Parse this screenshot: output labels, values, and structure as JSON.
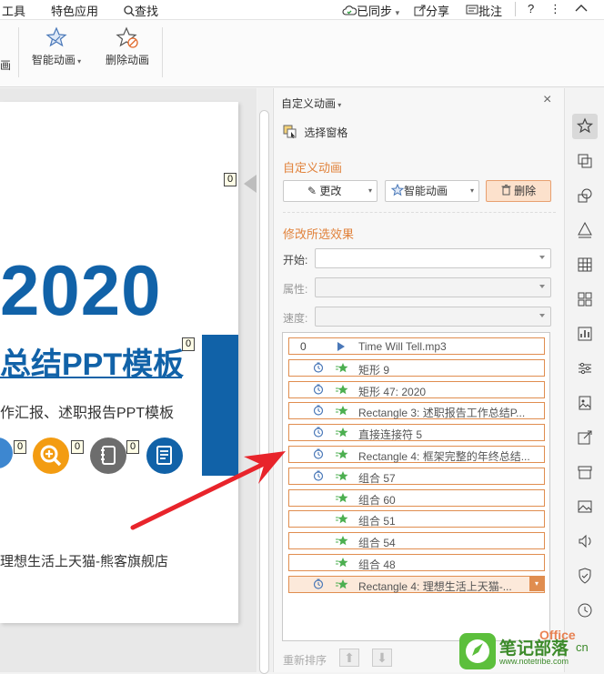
{
  "menubar": {
    "tools": "工具",
    "special": "特色应用",
    "search": "查找",
    "synced": "已同步",
    "share": "分享",
    "comment": "批注",
    "help": "?"
  },
  "ribbon": {
    "left_partial": "画",
    "smart_animation": "智能动画",
    "delete_animation": "删除动画"
  },
  "slide": {
    "year": "2020",
    "title": "总结PPT模板",
    "subtitle": "作汇报、述职报告PPT模板",
    "footer": "理想生活上天猫-熊客旗舰店",
    "tag": "0"
  },
  "panel": {
    "header": "自定义动画",
    "select_pane": "选择窗格",
    "section1": "自定义动画",
    "change": "更改",
    "smart": "智能动画",
    "delete": "删除",
    "section2": "修改所选效果",
    "start_label": "开始:",
    "property_label": "属性:",
    "speed_label": "速度:",
    "reorder": "重新排序"
  },
  "list": [
    {
      "ord": "0",
      "text": "Time Will Tell.mp3",
      "kind": "play"
    },
    {
      "ord": "",
      "text": "矩形 9",
      "kind": "clock"
    },
    {
      "ord": "",
      "text": "矩形 47: 2020",
      "kind": "clock"
    },
    {
      "ord": "",
      "text": "Rectangle 3: 述职报告工作总结P...",
      "kind": "clock"
    },
    {
      "ord": "",
      "text": "直接连接符 5",
      "kind": "clock"
    },
    {
      "ord": "",
      "text": "Rectangle 4: 框架完整的年终总结...",
      "kind": "clock"
    },
    {
      "ord": "",
      "text": "组合 57",
      "kind": "clock"
    },
    {
      "ord": "",
      "text": "组合 60",
      "kind": "none"
    },
    {
      "ord": "",
      "text": "组合 51",
      "kind": "none"
    },
    {
      "ord": "",
      "text": "组合 54",
      "kind": "none"
    },
    {
      "ord": "",
      "text": "组合 48",
      "kind": "none"
    },
    {
      "ord": "",
      "text": "Rectangle 4: 理想生活上天猫-...",
      "kind": "clock",
      "selected": true
    }
  ],
  "watermark": {
    "text": "笔记部落",
    "url": "www.notetribe.com",
    "office": "Office",
    "cn": "cn"
  },
  "colors": {
    "accent": "#e1823b",
    "blue": "#1162a8",
    "arrow": "#e8242b"
  }
}
